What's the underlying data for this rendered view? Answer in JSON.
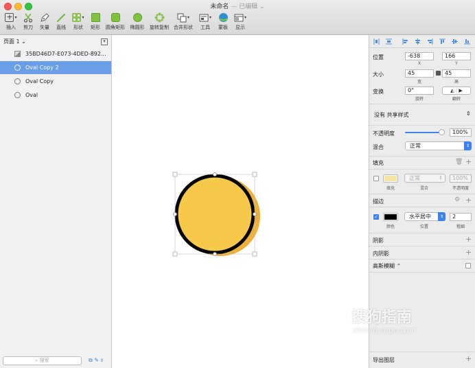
{
  "window": {
    "title": "未命名",
    "subtitle": "— 已编辑 ⌄"
  },
  "toolbar": [
    {
      "label": "插入",
      "icon": "plus-icon"
    },
    {
      "label": "剪刀",
      "icon": "scissors-icon"
    },
    {
      "label": "矢量",
      "icon": "pen-icon"
    },
    {
      "label": "直线",
      "icon": "line-icon"
    },
    {
      "label": "形状",
      "icon": "shapes-icon"
    },
    {
      "label": "矩形",
      "icon": "rectangle-icon"
    },
    {
      "label": "圆角矩形",
      "icon": "rounded-rectangle-icon"
    },
    {
      "label": "椭圆形",
      "icon": "oval-icon"
    },
    {
      "label": "旋转复制",
      "icon": "rotate-copy-icon"
    },
    {
      "label": "合并形状",
      "icon": "combine-shapes-icon"
    },
    {
      "label": "工具",
      "icon": "tools-icon"
    },
    {
      "label": "蒙板",
      "icon": "mask-icon"
    },
    {
      "label": "显示",
      "icon": "view-icon"
    }
  ],
  "left_panel": {
    "page_selector": "页面 1 ⌄",
    "layers": [
      {
        "name": "35BD46D7-E073-4DED-892...",
        "icon": "image-icon",
        "selected": false
      },
      {
        "name": "Oval Copy 2",
        "icon": "oval-icon",
        "selected": true
      },
      {
        "name": "Oval Copy",
        "icon": "oval-icon",
        "selected": false
      },
      {
        "name": "Oval",
        "icon": "oval-icon",
        "selected": false
      }
    ],
    "search_placeholder": "搜索",
    "filter_count": "0"
  },
  "canvas": {
    "shape_fill": "#f6c94a",
    "shadow_fill": "#f0b13a",
    "border_color": "#000000"
  },
  "inspector": {
    "position_label": "位置",
    "x_value": "-638",
    "y_value": "166",
    "x_label": "X",
    "y_label": "Y",
    "size_label": "大小",
    "width_value": "45",
    "height_value": "45",
    "width_label": "宽",
    "height_label": "高",
    "transform_label": "变换",
    "rotate_value": "0°",
    "rotate_label": "旋转",
    "flip_label": "翻转",
    "shared_style": "没有 共享样式",
    "opacity_label": "不透明度",
    "opacity_value": "100%",
    "blending_label": "混合",
    "blending_value": "正常",
    "fill_section": "填充",
    "fill_blend_value": "正常",
    "fill_opacity_value": "100%",
    "fill_color_label": "填充",
    "fill_blend_label": "混合",
    "fill_opacity_label": "不透明度",
    "fill_color": "#f7e3a3",
    "border_section": "描边",
    "border_position_value": "水平居中",
    "border_thickness_value": "2",
    "border_color_label": "颜色",
    "border_position_label": "位置",
    "border_thickness_label": "粗细",
    "border_color": "#000000",
    "shadows_section": "阴影",
    "inner_shadows_section": "内阴影",
    "gaussian_blur_section": "高斯模糊 ⌃",
    "export_section": "导出图层"
  },
  "watermark": {
    "main": "搜狗指南",
    "url": "zhinan.sogo.com"
  }
}
